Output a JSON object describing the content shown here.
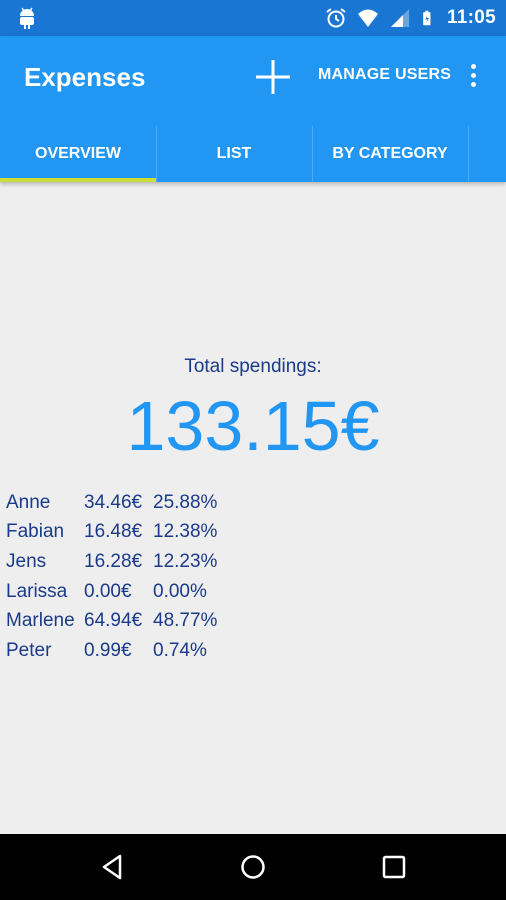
{
  "status_bar": {
    "time": "11:05",
    "icons": [
      "android-icon",
      "alarm-icon",
      "wifi-icon",
      "signal-icon",
      "battery-icon"
    ]
  },
  "app_bar": {
    "title": "Expenses",
    "add_icon": "plus-icon",
    "manage_label": "MANAGE USERS",
    "more_icon": "overflow-icon"
  },
  "tabs": [
    {
      "label": "OVERVIEW",
      "selected": true
    },
    {
      "label": "LIST",
      "selected": false
    },
    {
      "label": "BY CATEGORY",
      "selected": false
    }
  ],
  "overview": {
    "total_label": "Total spendings:",
    "total_value": "133.15€",
    "users": [
      {
        "name": "Anne",
        "amount": "34.46€",
        "percent": "25.88%"
      },
      {
        "name": "Fabian",
        "amount": "16.48€",
        "percent": "12.38%"
      },
      {
        "name": "Jens",
        "amount": "16.28€",
        "percent": "12.23%"
      },
      {
        "name": "Larissa",
        "amount": "0.00€",
        "percent": "0.00%"
      },
      {
        "name": "Marlene",
        "amount": "64.94€",
        "percent": "48.77%"
      },
      {
        "name": "Peter",
        "amount": "0.99€",
        "percent": "0.74%"
      }
    ]
  },
  "colors": {
    "status_bar": "#1976d2",
    "app_bar": "#2196f3",
    "tab_indicator": "#cddc39",
    "text_dark_blue": "#1a3a8a",
    "total_blue": "#2196f3"
  },
  "nav_bar": {
    "buttons": [
      "back-icon",
      "home-icon",
      "recents-icon"
    ]
  }
}
